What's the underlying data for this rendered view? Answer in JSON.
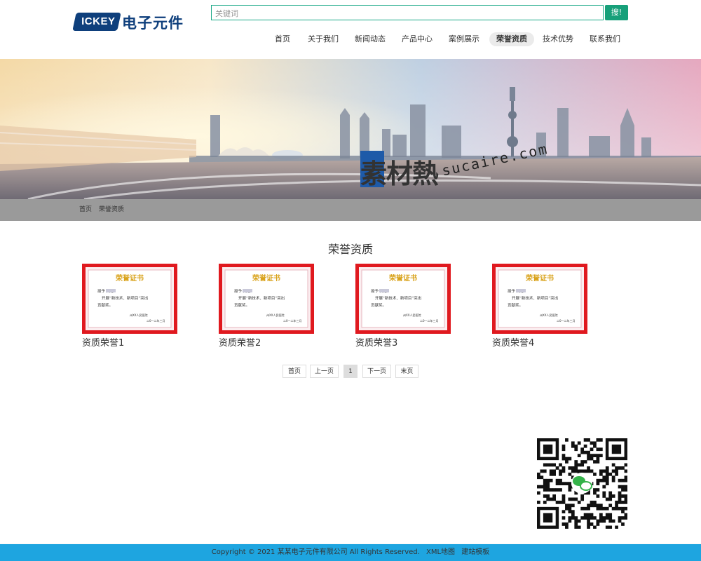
{
  "brand": {
    "badge": "ICKEY",
    "name": "电子元件"
  },
  "search": {
    "placeholder": "关键词",
    "button": "搜!"
  },
  "nav": {
    "items": [
      {
        "label": "首页",
        "active": false
      },
      {
        "label": "关于我们",
        "active": false
      },
      {
        "label": "新闻动态",
        "active": false
      },
      {
        "label": "产品中心",
        "active": false
      },
      {
        "label": "案例展示",
        "active": false
      },
      {
        "label": "荣誉资质",
        "active": true
      },
      {
        "label": "技术优势",
        "active": false
      },
      {
        "label": "联系我们",
        "active": false
      }
    ]
  },
  "banner": {
    "watermark_cn": "素材熱",
    "watermark_en": "sucaire.com"
  },
  "breadcrumb": {
    "home": "首页",
    "current": "荣誉资质"
  },
  "section": {
    "title": "荣誉资质"
  },
  "certificate_text": {
    "heading": "荣誉证书",
    "recipient_line": "授予",
    "body": "开展“新技术、新项目”突出贡献奖。",
    "line1": "授予    同志：",
    "line2": "开展“新技术、新项目”突出",
    "line3": "贡献奖。",
    "issuer": "州XX人民医院",
    "date": "二0一二年三月"
  },
  "certificates": [
    {
      "label": "资质荣誉1"
    },
    {
      "label": "资质荣誉2"
    },
    {
      "label": "资质荣誉3"
    },
    {
      "label": "资质荣誉4"
    }
  ],
  "pager": {
    "first": "首页",
    "prev": "上一页",
    "current": "1",
    "next": "下一页",
    "last": "末页"
  },
  "footer": {
    "copyright": "Copyright © 2021 某某电子元件有限公司 All Rights Reserved.",
    "sitemap": "XML地图",
    "template": "建站模板"
  },
  "colors": {
    "accent": "#19a886",
    "nav_active_bg": "#ebebeb",
    "footer_bg": "#1ea5e0",
    "cert_frame": "#e0191f"
  }
}
